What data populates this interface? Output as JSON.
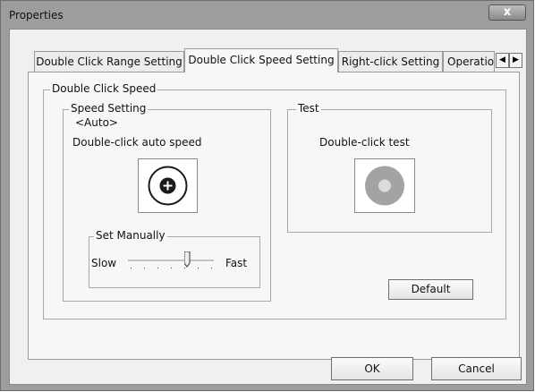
{
  "window": {
    "title": "Properties",
    "close_glyph": "x"
  },
  "tabs": [
    {
      "label": "Double Click Range Setting",
      "active": false
    },
    {
      "label": "Double Click Speed Setting",
      "active": true
    },
    {
      "label": "Right-click Setting",
      "active": false
    },
    {
      "label": "Operatio",
      "active": false
    }
  ],
  "tab_scroll": {
    "left": "◀",
    "right": "▶"
  },
  "double_click_speed": {
    "group_label": "Double Click Speed",
    "speed_setting": {
      "group_label": "Speed Setting",
      "mode": "<Auto>",
      "description": "Double-click auto speed",
      "icon": "double-click-auto-speed-icon"
    },
    "set_manually": {
      "group_label": "Set Manually",
      "slow_label": "Slow",
      "fast_label": "Fast",
      "slider_level": 0.7
    },
    "test": {
      "group_label": "Test",
      "description": "Double-click test",
      "icon": "double-click-test-target-icon"
    },
    "default_button": "Default"
  },
  "footer": {
    "ok_button": "OK",
    "cancel_button": "Cancel"
  }
}
